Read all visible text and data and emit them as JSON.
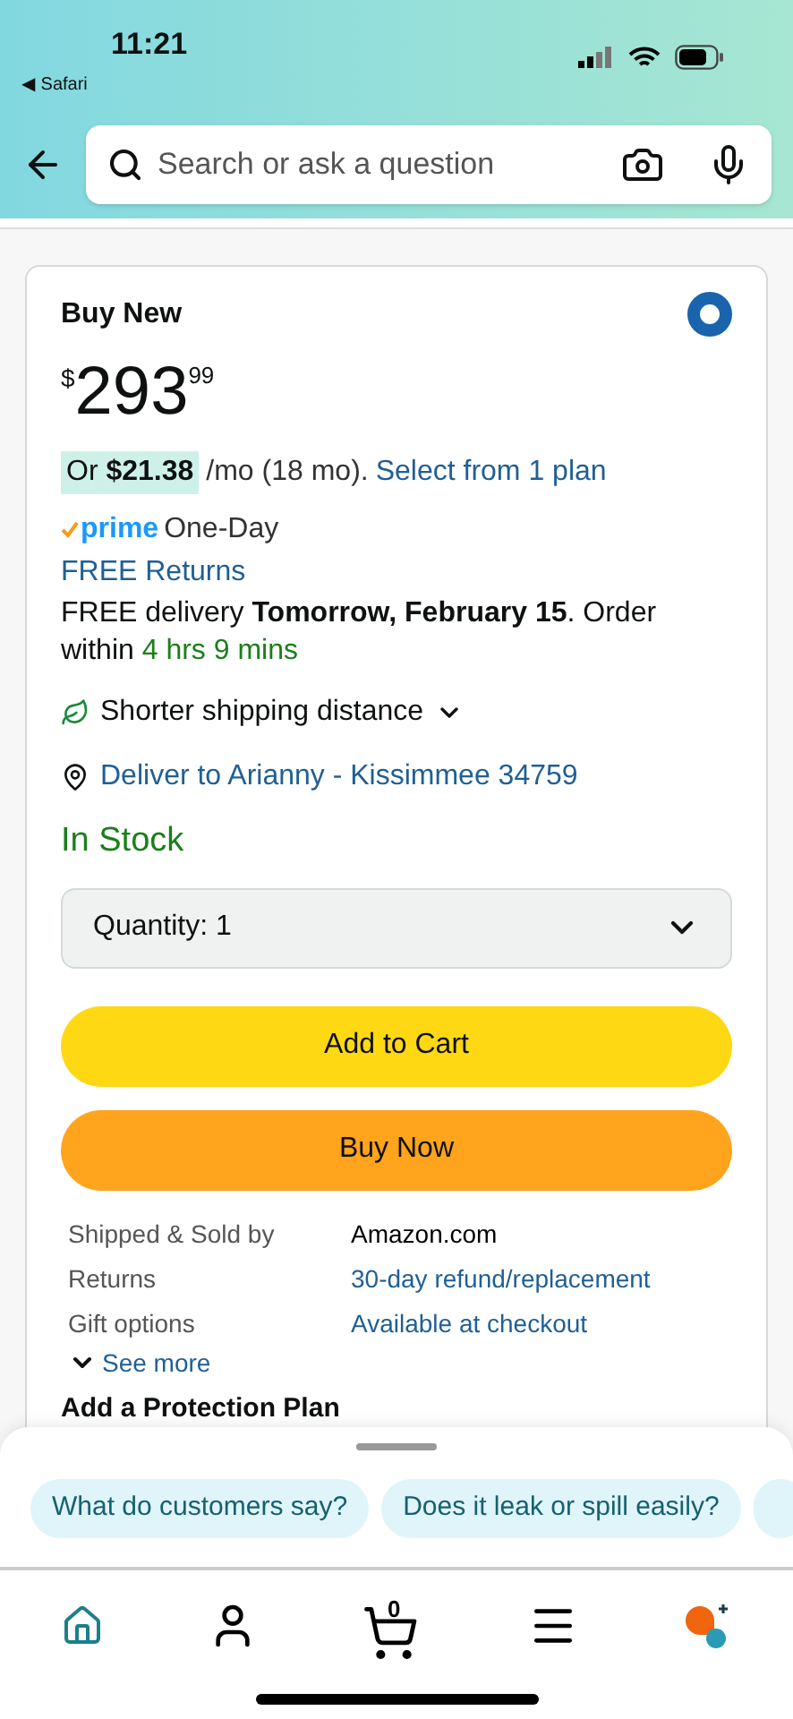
{
  "status_bar": {
    "time": "11:21",
    "back_app": "◀ Safari"
  },
  "search": {
    "placeholder": "Search or ask a question"
  },
  "offer": {
    "title": "Buy New",
    "selected": true,
    "currency": "$",
    "price_whole": "293",
    "price_fraction": "99",
    "installment": "Or **$21.38**",
    "installment_terms": "/mo (18 mo).",
    "plan_link": "Select from 1 plan",
    "prime": "prime",
    "prime_speed": "One-Day",
    "returns_link": "FREE Returns",
    "delivery": "FREE delivery **Tomorrow, February 15**. Order within",
    "countdown": "4 hrs 9 mins",
    "shipping_note": "Shorter shipping distance",
    "deliver_to": "Deliver to Arianny - Kissimmee 34759",
    "stock": "In Stock",
    "quantity": "Quantity: 1",
    "add_to_cart": "Add to Cart",
    "buy_now": "Buy Now",
    "details": [
      {
        "label": "Shipped & Sold by",
        "value": "Amazon.com",
        "link": false
      },
      {
        "label": "Returns",
        "value": "30-day refund/replacement",
        "link": true
      },
      {
        "label": "Gift options",
        "value": "Available at checkout",
        "link": true
      }
    ],
    "see_more": "See more",
    "next_section": "Add a Protection Plan"
  },
  "suggestions": [
    "What do customers say?",
    "Does it leak or spill easily?"
  ],
  "nav": [
    {
      "kind": "home",
      "selected": true
    },
    {
      "kind": "account",
      "selected": false
    },
    {
      "kind": "cart",
      "selected": false,
      "count": "0"
    },
    {
      "kind": "menu",
      "selected": false
    },
    {
      "kind": "assistant",
      "selected": false
    }
  ]
}
